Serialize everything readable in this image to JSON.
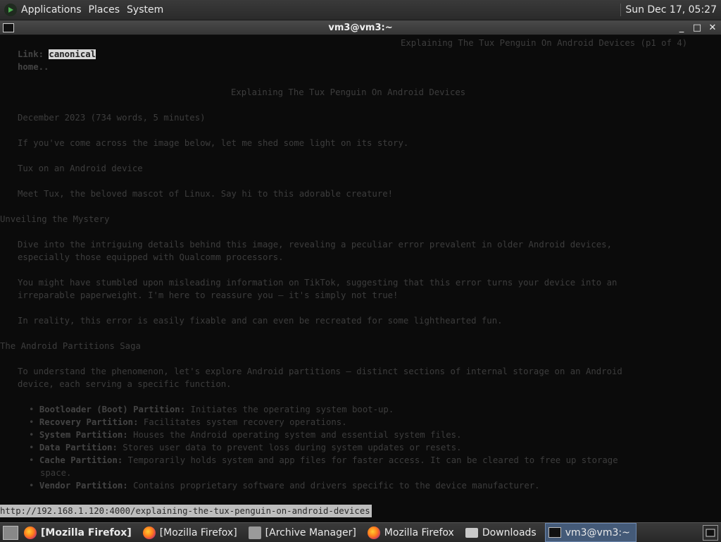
{
  "top_panel": {
    "menus": [
      "Applications",
      "Places",
      "System"
    ],
    "clock": "Sun Dec 17, 05:27"
  },
  "window": {
    "title": "vm3@vm3:~",
    "controls": [
      "_",
      "□",
      "✕"
    ]
  },
  "terminal": {
    "header_right": "Explaining The Tux Penguin On Android Devices (p1 of 4)",
    "link_prefix": "Link: ",
    "link_highlight": "canonical",
    "home": "home..",
    "article_title": "Explaining The Tux Penguin On Android Devices",
    "meta": "December 2023 (734 words, 5 minutes)",
    "p1": "If you've come across the image below, let me shed some light on its story.",
    "img_alt": "Tux on an Android device",
    "p2": "Meet Tux, the beloved mascot of Linux. Say hi to this adorable creature!",
    "h_mystery": "Unveiling the Mystery",
    "p3_l1": "Dive into the intriguing details behind this image, revealing a peculiar error prevalent in older Android devices,",
    "p3_l2": "especially those equipped with Qualcomm processors.",
    "p4_l1": "You might have stumbled upon misleading information on TikTok, suggesting that this error turns your device into an",
    "p4_l2": "irreparable paperweight. I'm here to reassure you – it's simply not true!",
    "p5": "In reality, this error is easily fixable and can even be recreated for some lighthearted fun.",
    "h_partitions": "The Android Partitions Saga",
    "p6_l1": "To understand the phenomenon, let's explore Android partitions – distinct sections of internal storage on an Android",
    "p6_l2": "device, each serving a specific function.",
    "bullets": [
      {
        "label": "Bootloader (Boot) Partition:",
        "text": " Initiates the operating system boot-up."
      },
      {
        "label": "Recovery Partition:",
        "text": " Facilitates system recovery operations."
      },
      {
        "label": "System Partition:",
        "text": " Houses the Android operating system and essential system files."
      },
      {
        "label": "Data Partition:",
        "text": " Stores user data to prevent loss during system updates or resets."
      },
      {
        "label": "Cache Partition:",
        "text": " Temporarily holds system and app files for faster access. It can be cleared to free up storage"
      },
      {
        "label": "",
        "text": "space."
      },
      {
        "label": "Vendor Partition:",
        "text": " Contains proprietary software and drivers specific to the device manufacturer."
      }
    ],
    "status_url": "http://192.168.1.120:4000/explaining-the-tux-penguin-on-android-devices"
  },
  "taskbar": {
    "tasks": [
      {
        "label": "[Mozilla Firefox]",
        "icon": "firefox-icon"
      },
      {
        "label": "[Mozilla Firefox]",
        "icon": "firefox-icon"
      },
      {
        "label": "[Archive Manager]",
        "icon": "archive-manager-icon"
      },
      {
        "label": "Mozilla Firefox",
        "icon": "firefox-icon"
      },
      {
        "label": "Downloads",
        "icon": "folder-icon"
      },
      {
        "label": "vm3@vm3:~",
        "icon": "terminal-icon"
      }
    ]
  }
}
